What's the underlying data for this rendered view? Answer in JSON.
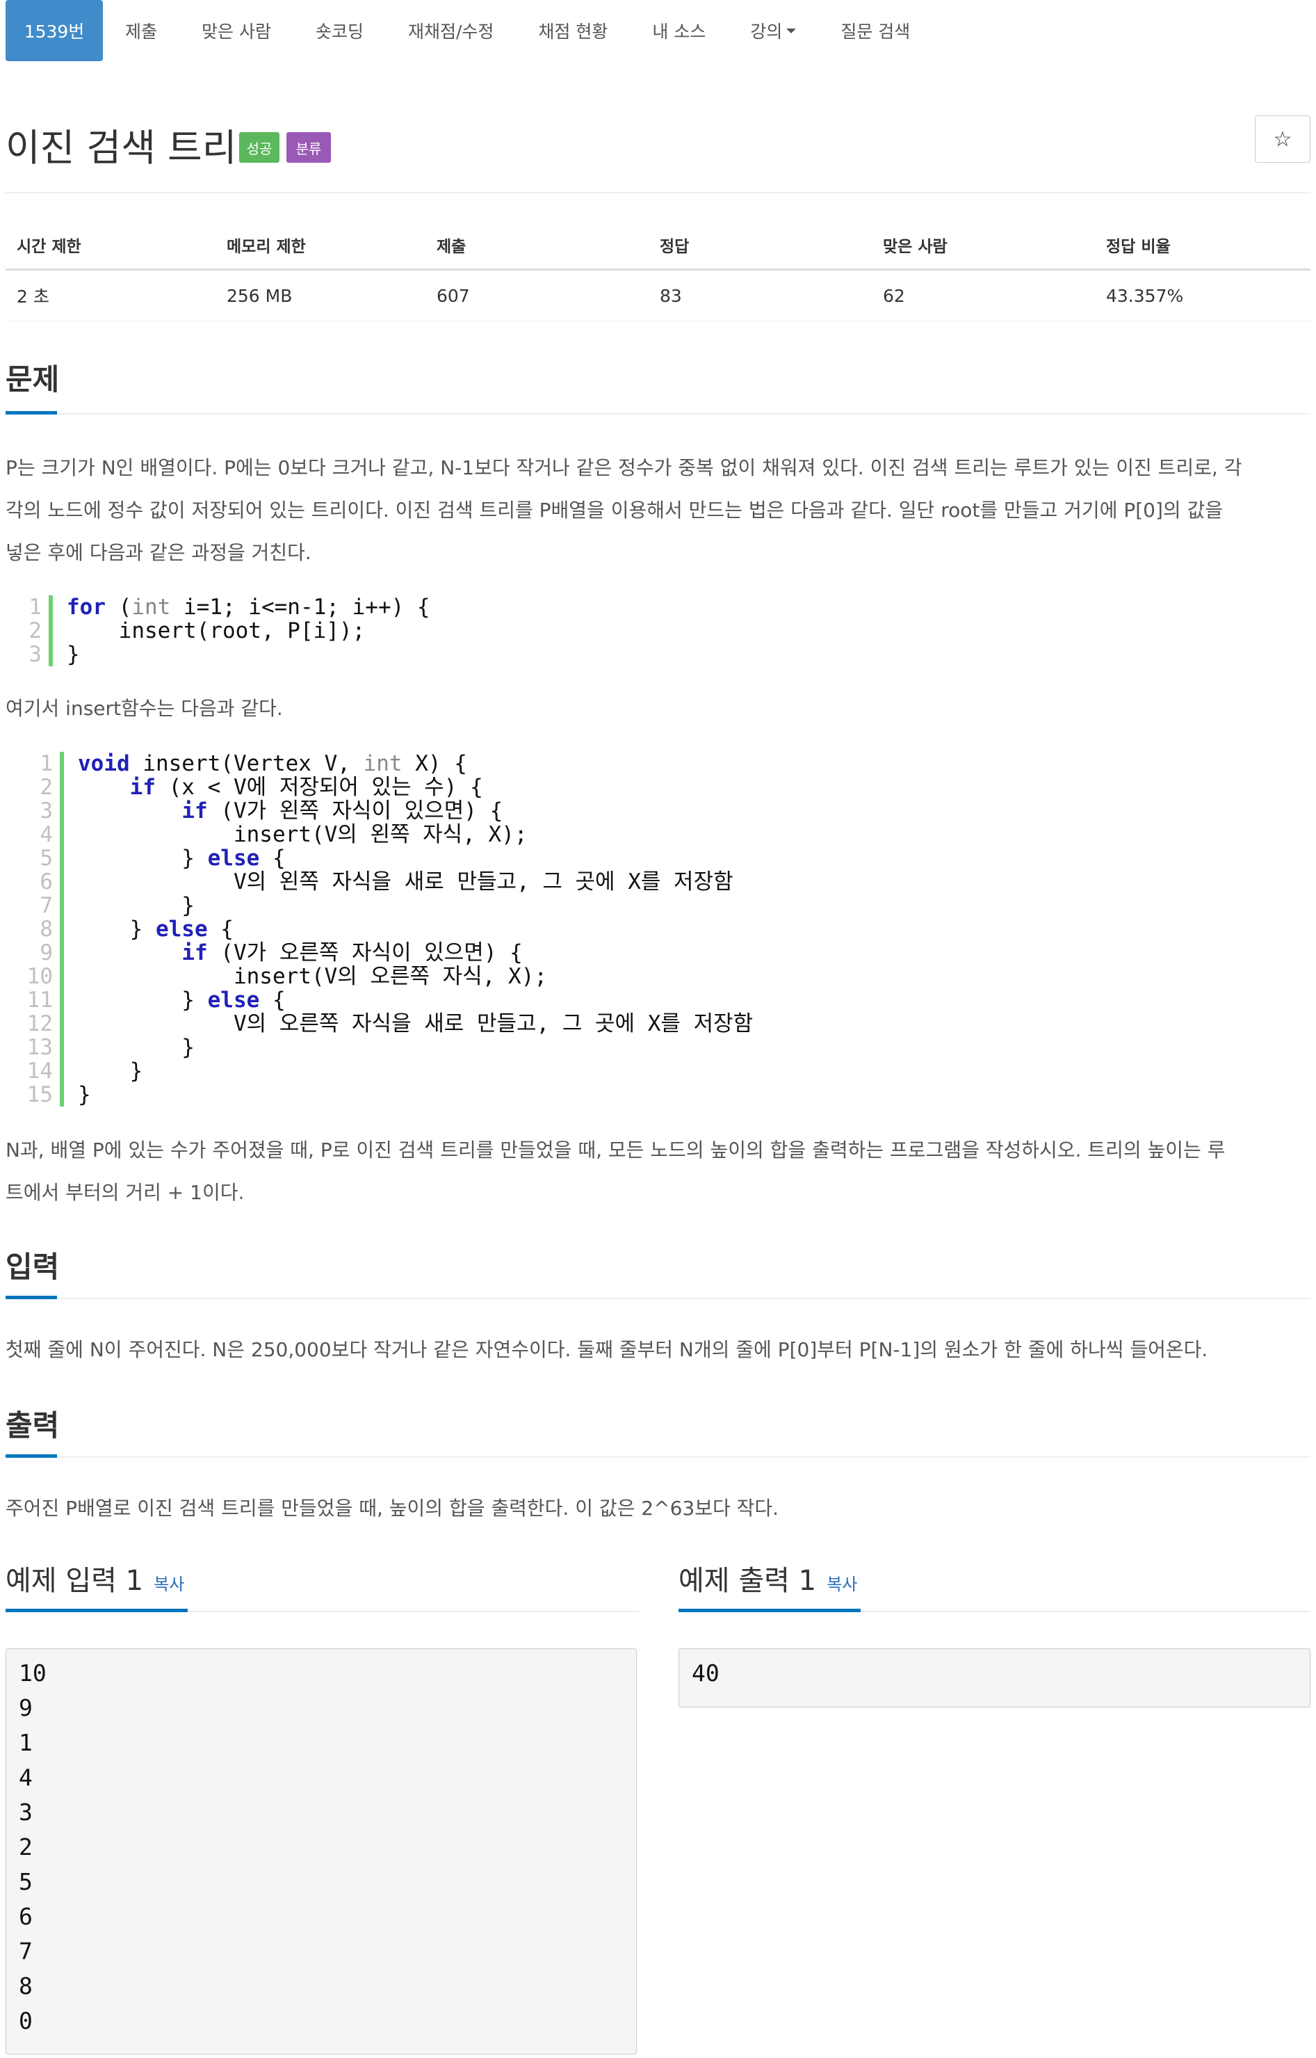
{
  "nav": {
    "items": [
      {
        "label": "1539번",
        "active": true
      },
      {
        "label": "제출"
      },
      {
        "label": "맞은 사람"
      },
      {
        "label": "숏코딩"
      },
      {
        "label": "재채점/수정"
      },
      {
        "label": "채점 현황"
      },
      {
        "label": "내 소스"
      },
      {
        "label": "강의",
        "dropdown": true
      },
      {
        "label": "질문 검색"
      }
    ]
  },
  "problem": {
    "title": "이진 검색 트리",
    "badges": [
      {
        "label": "성공",
        "color": "#5cb85c"
      },
      {
        "label": "분류",
        "color": "#9b59b6"
      }
    ],
    "star_icon": "☆"
  },
  "info": {
    "headers": [
      "시간 제한",
      "메모리 제한",
      "제출",
      "정답",
      "맞은 사람",
      "정답 비율"
    ],
    "values": [
      "2 초",
      "256 MB",
      "607",
      "83",
      "62",
      "43.357%"
    ]
  },
  "sections": {
    "problem": "문제",
    "input": "입력",
    "output": "출력"
  },
  "description": {
    "p1_line1": "P는 크기가 N인 배열이다. P에는 0보다 크거나 같고, N-1보다 작거나 같은 정수가 중복 없이 채워져 있다. 이진 검색 트리는 루트가 있는 이진 트리로, 각",
    "p1_line2": "각의 노드에 정수 값이 저장되어 있는 트리이다. 이진 검색 트리를 P배열을 이용해서 만드는 법은 다음과 같다. 일단 root를 만들고 거기에 P[0]의 값을",
    "p1_line3": "넣은 후에 다음과 같은 과정을 거친다.",
    "p2": "여기서 insert함수는 다음과 같다.",
    "p3_line1": "N과, 배열 P에 있는 수가 주어졌을 때, P로 이진 검색 트리를 만들었을 때, 모든 노드의 높이의 합을 출력하는 프로그램을 작성하시오. 트리의 높이는 루",
    "p3_line2": "트에서 부터의 거리 + 1이다."
  },
  "code1": [
    {
      "n": "1",
      "text": "for (int i=1; i<=n-1; i++) {"
    },
    {
      "n": "2",
      "text": "    insert(root, P[i]);"
    },
    {
      "n": "3",
      "text": "}"
    }
  ],
  "code2": [
    {
      "n": "1",
      "text": "void insert(Vertex V, int X) {"
    },
    {
      "n": "2",
      "text": "    if (x < V에 저장되어 있는 수) {"
    },
    {
      "n": "3",
      "text": "        if (V가 왼쪽 자식이 있으면) {"
    },
    {
      "n": "4",
      "text": "            insert(V의 왼쪽 자식, X);"
    },
    {
      "n": "5",
      "text": "        } else {"
    },
    {
      "n": "6",
      "text": "            V의 왼쪽 자식을 새로 만들고, 그 곳에 X를 저장함"
    },
    {
      "n": "7",
      "text": "        }"
    },
    {
      "n": "8",
      "text": "    } else {"
    },
    {
      "n": "9",
      "text": "        if (V가 오른쪽 자식이 있으면) {"
    },
    {
      "n": "10",
      "text": "            insert(V의 오른쪽 자식, X);"
    },
    {
      "n": "11",
      "text": "        } else {"
    },
    {
      "n": "12",
      "text": "            V의 오른쪽 자식을 새로 만들고, 그 곳에 X를 저장함"
    },
    {
      "n": "13",
      "text": "        }"
    },
    {
      "n": "14",
      "text": "    }"
    },
    {
      "n": "15",
      "text": "}"
    }
  ],
  "input_text": "첫째 줄에 N이 주어진다. N은 250,000보다 작거나 같은 자연수이다. 둘째 줄부터 N개의 줄에 P[0]부터 P[N-1]의 원소가 한 줄에 하나씩 들어온다.",
  "output_text": "주어진 P배열로 이진 검색 트리를 만들었을 때, 높이의 합을 출력한다. 이 값은 2^63보다 작다.",
  "samples": {
    "input_title": "예제 입력 1",
    "output_title": "예제 출력 1",
    "copy_label": "복사",
    "input_data": "10\n9\n1\n4\n3\n2\n5\n6\n7\n8\n0",
    "output_data": "40"
  }
}
